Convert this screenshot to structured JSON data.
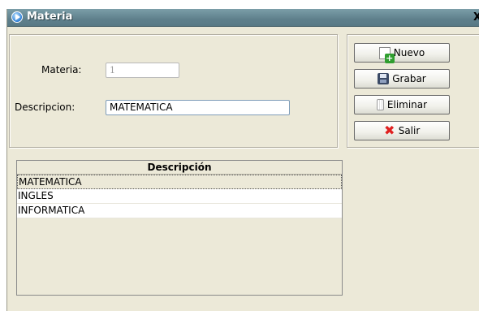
{
  "window": {
    "title": "Materia",
    "close_glyph": "X",
    "icon": "app-icon"
  },
  "form": {
    "materia_label": "Materia:",
    "materia_value": "1",
    "descripcion_label": "Descripcion:",
    "descripcion_value": "MATEMATICA"
  },
  "toolbar": {
    "nuevo_label": "Nuevo",
    "grabar_label": "Grabar",
    "eliminar_label": "Eliminar",
    "salir_label": "Salir"
  },
  "table": {
    "header": "Descripción",
    "rows": [
      "MATEMATICA",
      "INGLES",
      "INFORMATICA"
    ],
    "selected_index": 0
  }
}
